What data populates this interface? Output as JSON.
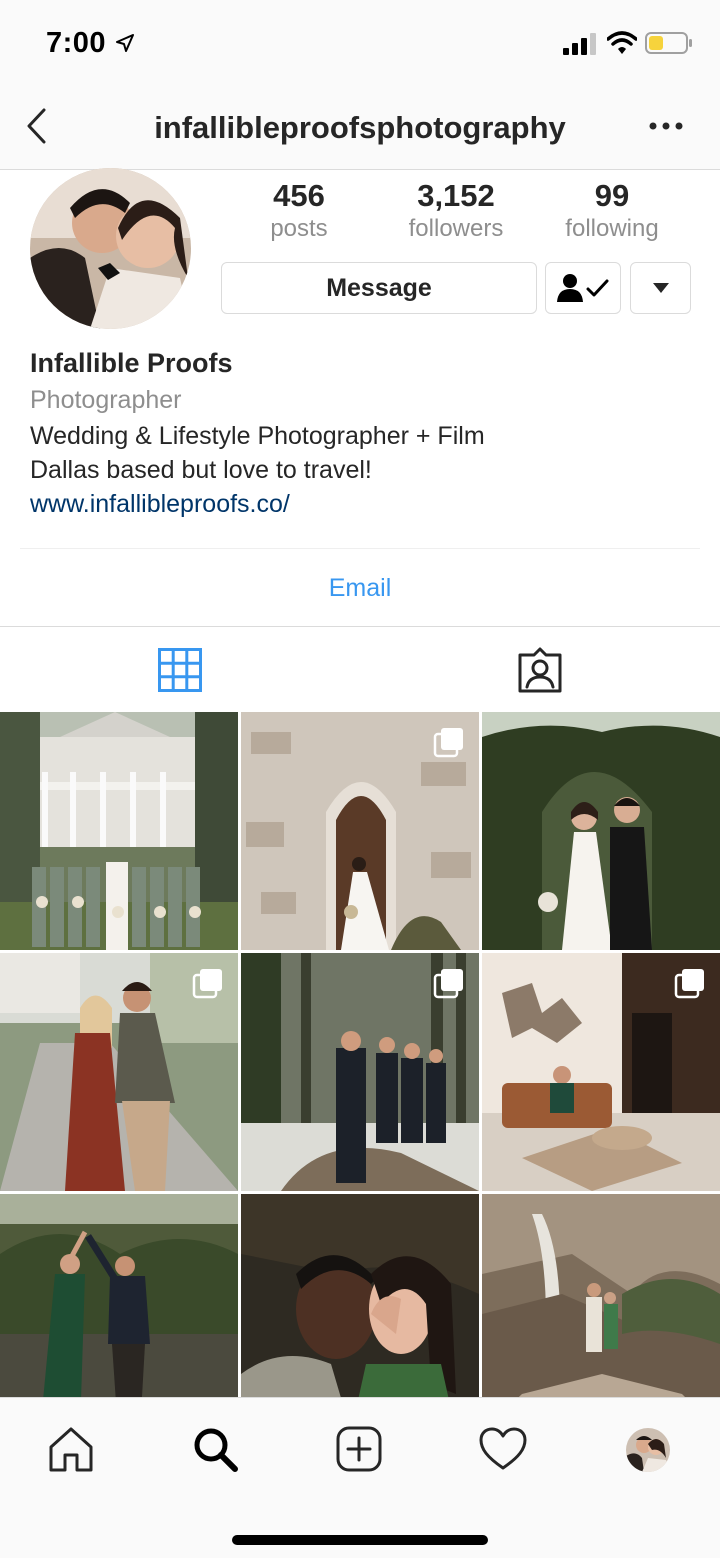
{
  "status_bar": {
    "time": "7:00",
    "icons": [
      "location-arrow-icon",
      "signal-icon",
      "wifi-icon",
      "battery-icon"
    ]
  },
  "header": {
    "username": "infallibleproofsphotography",
    "back_icon": "chevron-left-icon",
    "more_icon": "ellipsis-icon"
  },
  "stats": {
    "posts": {
      "value": "456",
      "label": "posts"
    },
    "followers": {
      "value": "3,152",
      "label": "followers"
    },
    "following": {
      "value": "99",
      "label": "following"
    }
  },
  "actions": {
    "message_label": "Message",
    "follow_icon": "person-check-icon",
    "dropdown_icon": "caret-down-icon"
  },
  "bio": {
    "name": "Infallible Proofs",
    "category": "Photographer",
    "lines": [
      "Wedding & Lifestyle Photographer + Film",
      "Dallas based but love to travel!"
    ],
    "link": "www.infallibleproofs.co/"
  },
  "contact": {
    "email_label": "Email"
  },
  "tabs": [
    {
      "name": "grid",
      "icon": "grid-icon",
      "active": true
    },
    {
      "name": "tagged",
      "icon": "tagged-person-icon",
      "active": false
    }
  ],
  "posts": [
    {
      "id": 1,
      "multi": false
    },
    {
      "id": 2,
      "multi": true
    },
    {
      "id": 3,
      "multi": false
    },
    {
      "id": 4,
      "multi": true
    },
    {
      "id": 5,
      "multi": true
    },
    {
      "id": 6,
      "multi": true
    },
    {
      "id": 7,
      "multi": false
    },
    {
      "id": 8,
      "multi": false
    },
    {
      "id": 9,
      "multi": false
    }
  ],
  "bottom_nav": [
    "home-icon",
    "search-icon",
    "add-post-icon",
    "heart-icon",
    "profile-avatar"
  ],
  "colors": {
    "accent_blue": "#3897f0",
    "link_blue": "#003569",
    "text": "#262626",
    "secondary": "#8e8e8e",
    "divider": "#dbdbdb"
  }
}
